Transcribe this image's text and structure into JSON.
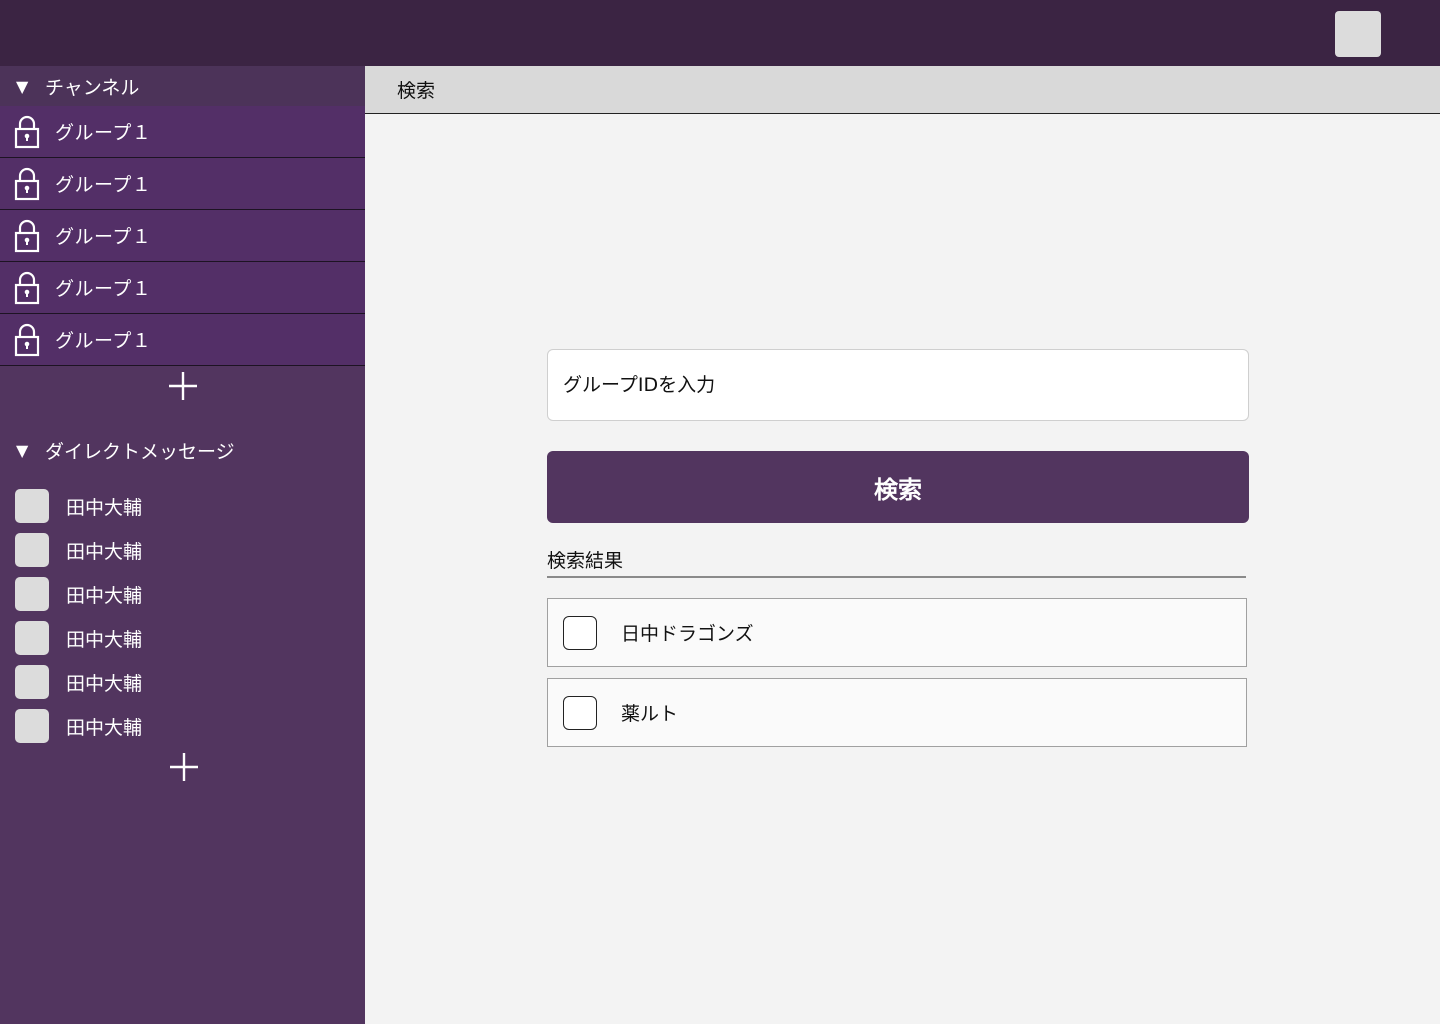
{
  "sidebar": {
    "channels": {
      "title": "チャンネル",
      "items": [
        {
          "label": "グループ１"
        },
        {
          "label": "グループ１"
        },
        {
          "label": "グループ１"
        },
        {
          "label": "グループ１"
        },
        {
          "label": "グループ１"
        }
      ]
    },
    "direct_messages": {
      "title": "ダイレクトメッセージ",
      "items": [
        {
          "label": "田中大輔"
        },
        {
          "label": "田中大輔"
        },
        {
          "label": "田中大輔"
        },
        {
          "label": "田中大輔"
        },
        {
          "label": "田中大輔"
        },
        {
          "label": "田中大輔"
        }
      ]
    }
  },
  "main": {
    "header_title": "検索",
    "search": {
      "placeholder": "グループIDを入力",
      "value": "",
      "button_label": "検索"
    },
    "results": {
      "title": "検索結果",
      "items": [
        {
          "label": "日中ドラゴンズ",
          "checked": false
        },
        {
          "label": "薬ルト",
          "checked": false
        }
      ]
    }
  },
  "colors": {
    "topbar": "#3b2443",
    "sidebar": "#52355f",
    "channel_item": "#532f67",
    "accent_button": "#52355f",
    "main_background": "#f3f3f3"
  },
  "icons": {
    "channel_item": "lock-icon",
    "section_toggle": "triangle-down-icon",
    "add": "plus-icon"
  }
}
